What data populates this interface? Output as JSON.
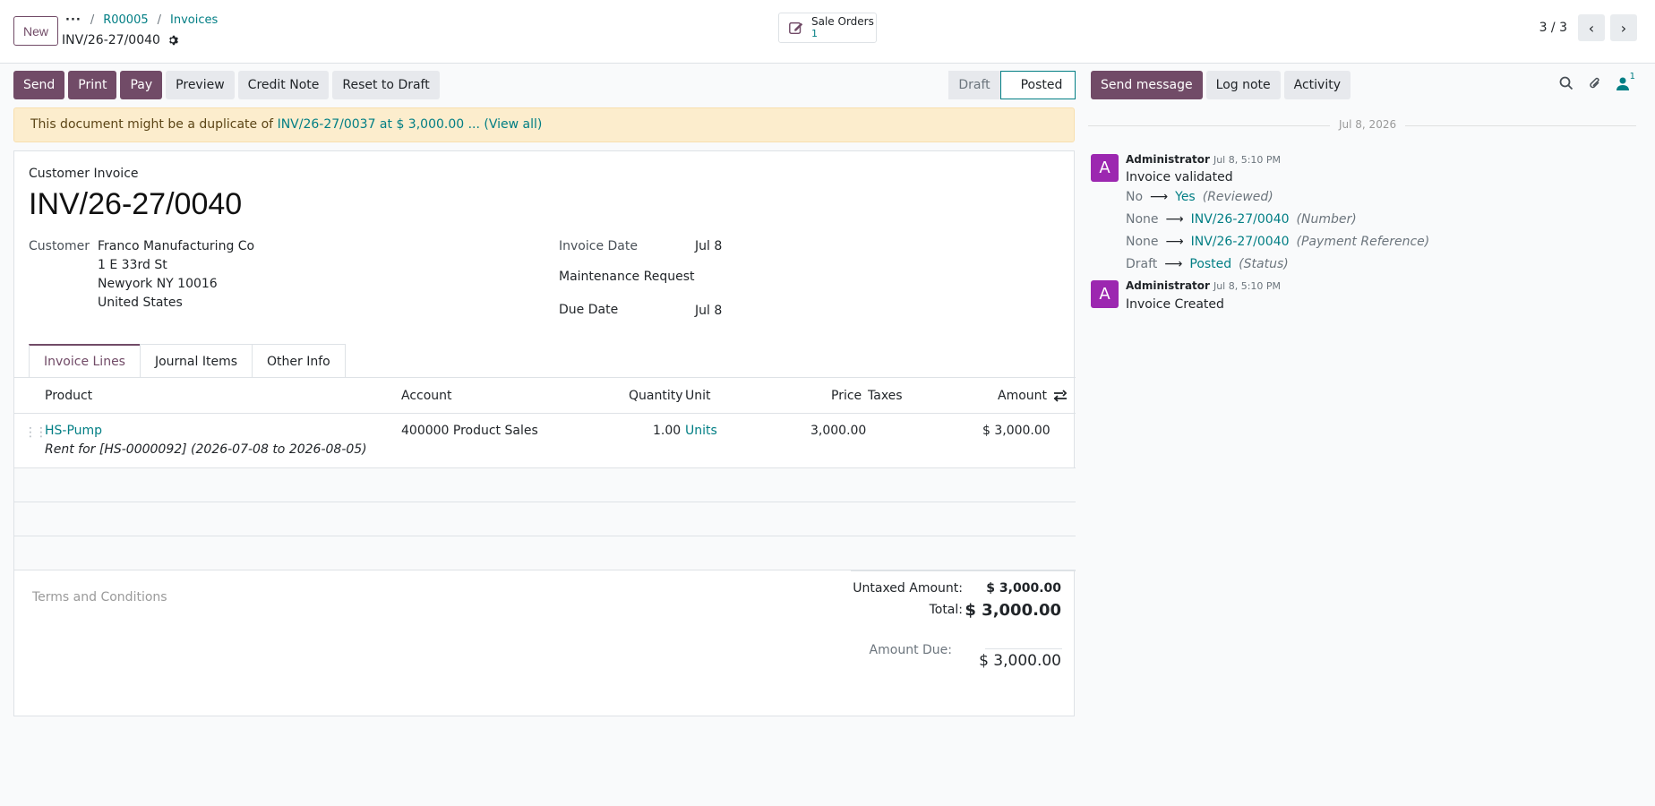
{
  "header": {
    "new_label": "New",
    "breadcrumb": [
      "R00005",
      "Invoices"
    ],
    "record_title": "INV/26-27/0040",
    "smart_button": {
      "label": "Sale Orders",
      "count": "1"
    },
    "pager": "3 / 3"
  },
  "actions": [
    "Send",
    "Print",
    "Pay",
    "Preview",
    "Credit Note",
    "Reset to Draft"
  ],
  "status": {
    "draft": "Draft",
    "posted": "Posted"
  },
  "alert": {
    "prefix": "This document might be a duplicate of",
    "link": "INV/26-27/0037 at $ 3,000.00 ... (View all)"
  },
  "form": {
    "doc_type": "Customer Invoice",
    "doc_name": "INV/26-27/0040",
    "customer_label": "Customer",
    "customer_name": "Franco Manufacturing Co",
    "address": [
      "1 E 33rd St",
      "Newyork NY 10016",
      "United States"
    ],
    "invoice_date_label": "Invoice Date",
    "invoice_date": "Jul 8",
    "maintenance_label": "Maintenance Request",
    "due_date_label": "Due Date",
    "due_date": "Jul 8"
  },
  "tabs": [
    "Invoice Lines",
    "Journal Items",
    "Other Info"
  ],
  "table": {
    "columns": [
      "Product",
      "Account",
      "Quantity",
      "Unit",
      "Price",
      "Taxes",
      "Amount"
    ],
    "rows": [
      {
        "product": "HS-Pump",
        "description": "Rent for  [HS-0000092] (2026-07-08 to 2026-08-05)",
        "account": "400000 Product Sales",
        "quantity": "1.00",
        "unit": "Units",
        "price": "3,000.00",
        "taxes": "",
        "amount": "$ 3,000.00"
      }
    ]
  },
  "terms_placeholder": "Terms and Conditions",
  "totals": {
    "untaxed_label": "Untaxed Amount:",
    "untaxed": "$ 3,000.00",
    "total_label": "Total:",
    "total": "$ 3,000.00",
    "due_label": "Amount Due:",
    "due": "$ 3,000.00"
  },
  "chatter": {
    "buttons": [
      "Send message",
      "Log note",
      "Activity"
    ],
    "followers": "1",
    "date": "Jul 8, 2026",
    "messages": [
      {
        "avatar": "A",
        "author": "Administrator",
        "time": "Jul 8, 5:10 PM",
        "body": "Invoice validated",
        "tracking": [
          {
            "old": "No",
            "new": "Yes",
            "field": "(Reviewed)"
          },
          {
            "old": "None",
            "new": "INV/26-27/0040",
            "field": "(Number)"
          },
          {
            "old": "None",
            "new": "INV/26-27/0040",
            "field": "(Payment Reference)"
          },
          {
            "old": "Draft",
            "new": "Posted",
            "field": "(Status)"
          }
        ]
      },
      {
        "avatar": "A",
        "author": "Administrator",
        "time": "Jul 8, 5:10 PM",
        "body": "Invoice Created"
      }
    ]
  },
  "colors": {
    "primary": "#714b67",
    "link": "#017e84",
    "alert_bg": "#fcedcd",
    "avatar": "#9c27b0"
  }
}
